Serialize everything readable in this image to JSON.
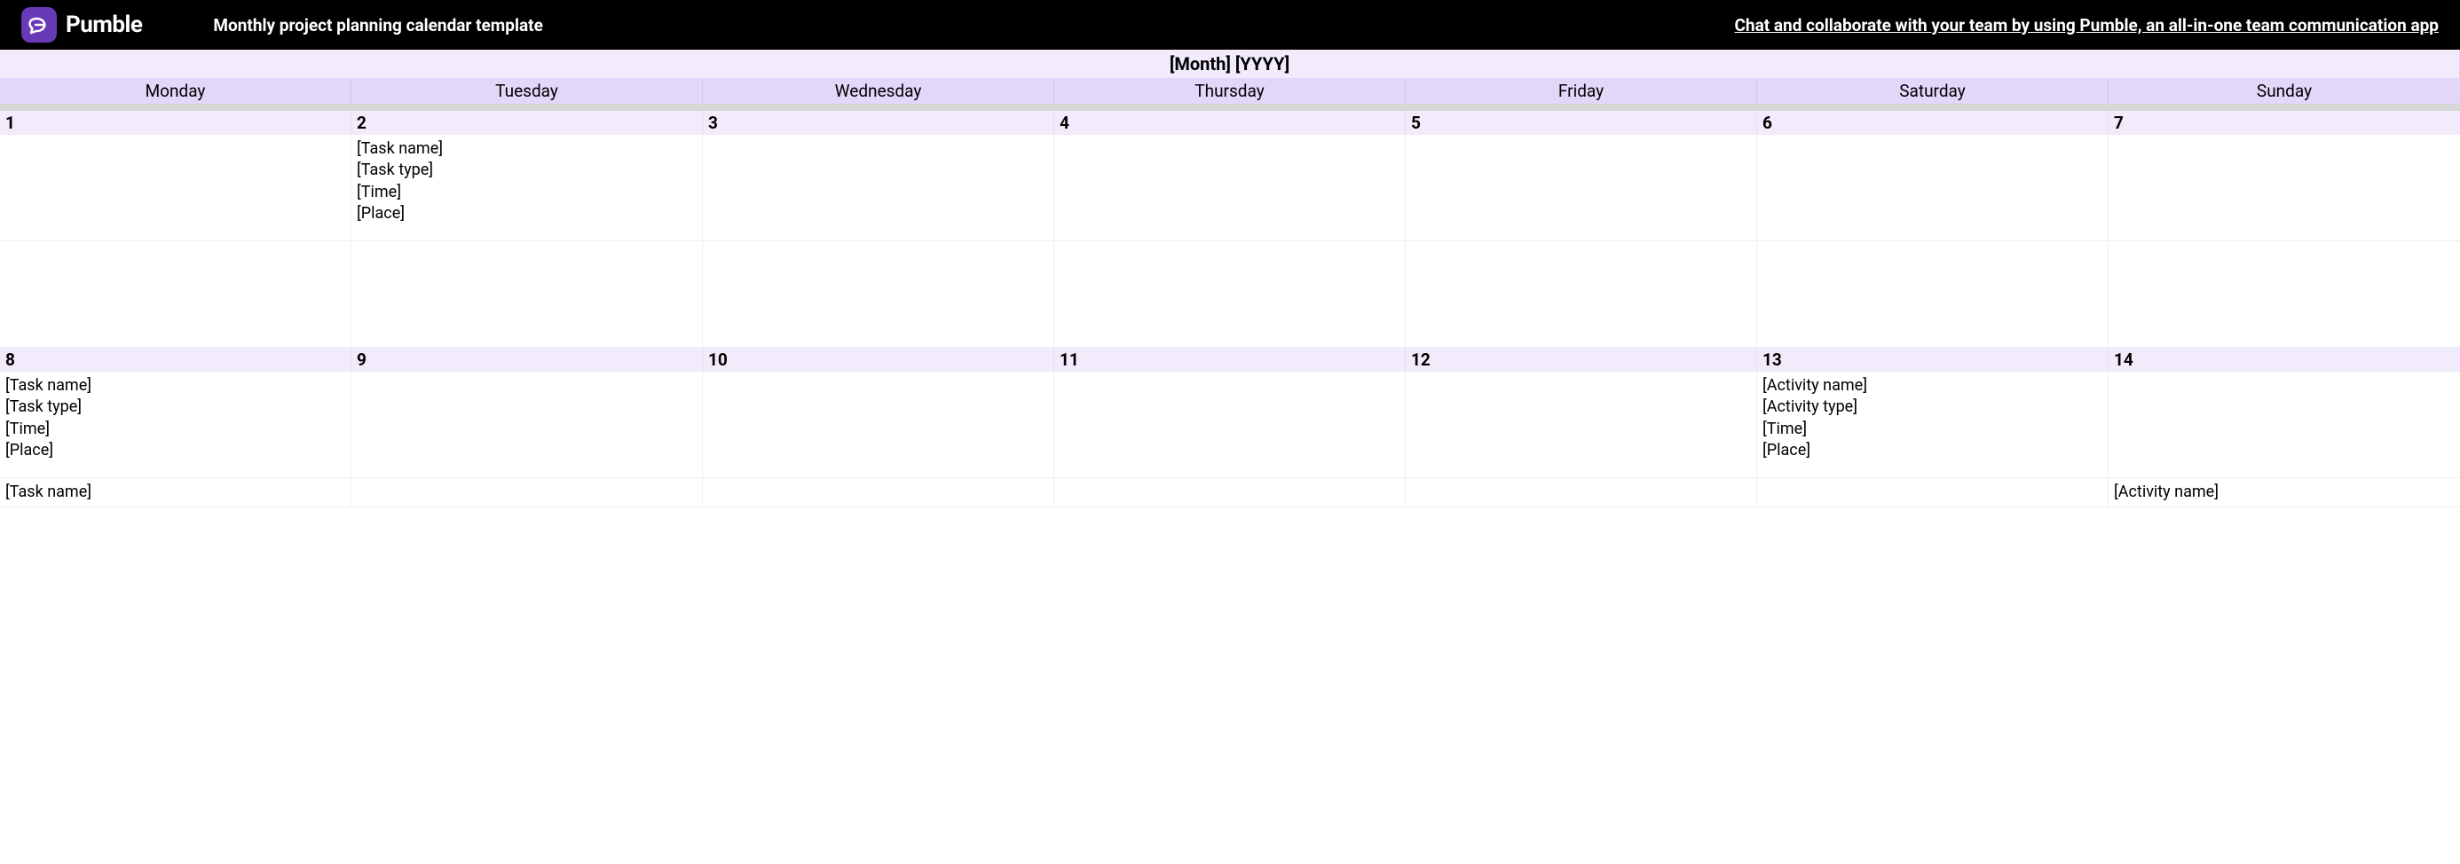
{
  "header": {
    "brand": "Pumble",
    "title": "Monthly project planning calendar template",
    "tagline": "Chat and collaborate with your team by using Pumble, an all-in-one team communication app"
  },
  "calendar": {
    "month_label": "[Month] [YYYY]",
    "day_names": [
      "Monday",
      "Tuesday",
      "Wednesday",
      "Thursday",
      "Friday",
      "Saturday",
      "Sunday"
    ],
    "week1_nums": [
      "1",
      "2",
      "3",
      "4",
      "5",
      "6",
      "7"
    ],
    "week2_nums": [
      "8",
      "9",
      "10",
      "11",
      "12",
      "13",
      "14"
    ]
  },
  "entries": {
    "day2": {
      "l1": "[Task name]",
      "l2": "[Task type]",
      "l3": "[Time]",
      "l4": "[Place]"
    },
    "day8": {
      "l1": "[Task name]",
      "l2": "[Task type]",
      "l3": "[Time]",
      "l4": "[Place]"
    },
    "day13": {
      "l1": "[Activity name]",
      "l2": "[Activity type]",
      "l3": "[Time]",
      "l4": "[Place]"
    },
    "day8b": {
      "l1": "[Task name]"
    },
    "day14b": {
      "l1": "[Activity name]"
    }
  }
}
